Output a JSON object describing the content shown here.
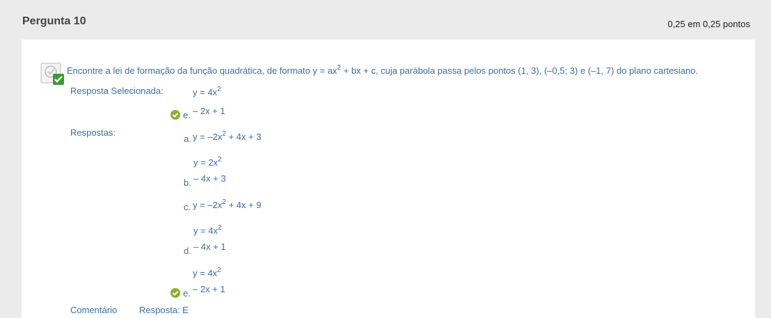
{
  "question": {
    "title": "Pergunta 10",
    "points": "0,25 em 0,25 pontos",
    "text_before": "Encontre a lei de formação da função quadrática, de formato y = ax",
    "text_sup": "2",
    "text_after": " + bx + c, cuja parábola passa pelos pontos (1, 3), (–0,5; 3) e (–1, 7) do plano cartesiano."
  },
  "selected": {
    "label": "Resposta Selecionada:",
    "line1": "y = 4x",
    "line1_sup": "2",
    "letter": "e.",
    "line2": "– 2x + 1"
  },
  "answers": {
    "label": "Respostas:",
    "a": {
      "letter": "a.",
      "text": "y = –2x",
      "sup": "2",
      "rest": " + 4x + 3"
    },
    "b": {
      "letter": "b.",
      "line1": "y = 2x",
      "sup": "2",
      "line2": "– 4x + 3"
    },
    "c": {
      "letter": "c.",
      "text": "y = –2x",
      "sup": "2",
      "rest": " + 4x + 9"
    },
    "d": {
      "letter": "d.",
      "line1": "y = 4x",
      "sup": "2",
      "line2": "– 4x + 1"
    },
    "e": {
      "letter": "e.",
      "line1": "y = 4x",
      "sup": "2",
      "line2": "– 2x + 1"
    }
  },
  "footer": {
    "comment_label": "Comentário",
    "comment_text": "Resposta: E"
  },
  "colors": {
    "link_blue": "#3a6ea5",
    "check_green": "#8ab22e",
    "bg": "#ebebeb"
  },
  "icons": {
    "question": "question-status-icon",
    "correct": "check-circle-icon"
  }
}
